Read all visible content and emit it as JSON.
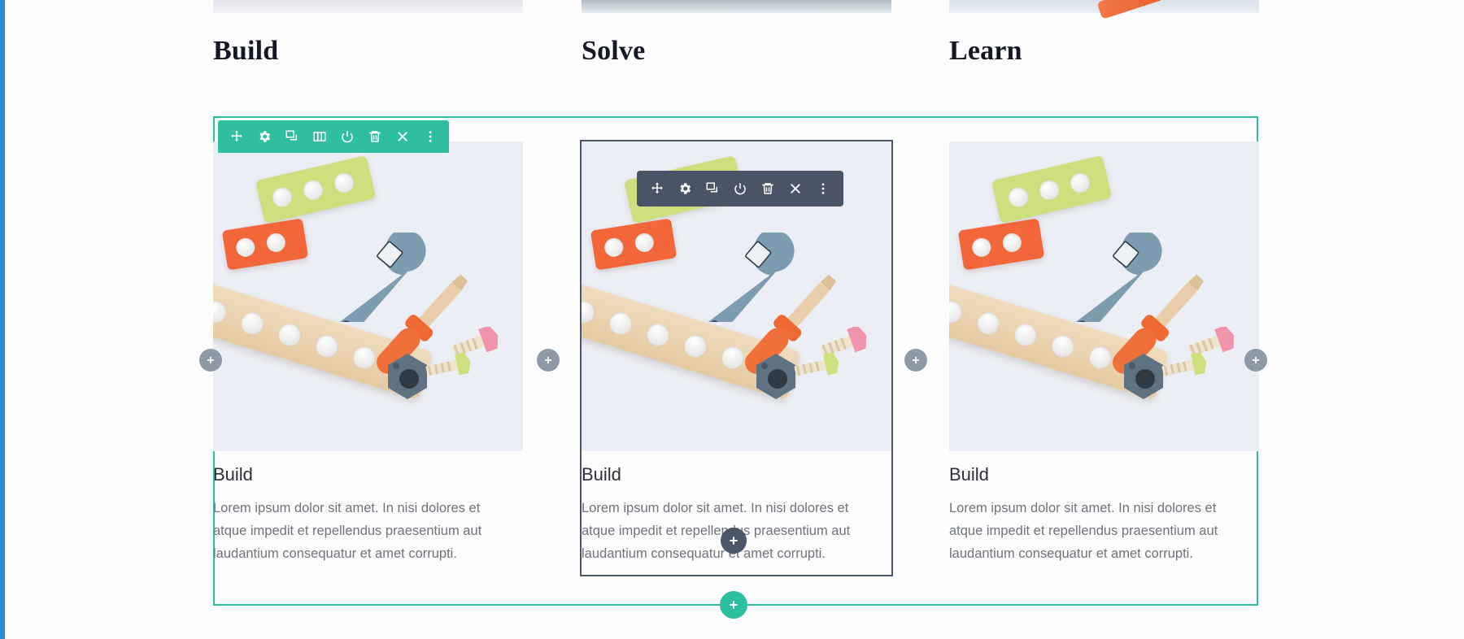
{
  "page": {
    "canvas_bg": "#fdfdfd",
    "editor_rail_color": "#2e8ddb",
    "section_accent": "#2fbfa0",
    "widget_accent": "#495566"
  },
  "headings": [
    {
      "label": "Build"
    },
    {
      "label": "Solve"
    },
    {
      "label": "Learn"
    }
  ],
  "section_toolbar": {
    "name": "section-toolbar",
    "color": "#2fbfa0",
    "items": [
      {
        "icon": "move-icon",
        "label": "Drag section"
      },
      {
        "icon": "gear-icon",
        "label": "Edit section"
      },
      {
        "icon": "duplicate-icon",
        "label": "Duplicate section"
      },
      {
        "icon": "columns-icon",
        "label": "Column structure"
      },
      {
        "icon": "power-icon",
        "label": "Disable section"
      },
      {
        "icon": "trash-icon",
        "label": "Delete section"
      },
      {
        "icon": "close-icon",
        "label": "Close"
      },
      {
        "icon": "more-vertical-icon",
        "label": "More options"
      }
    ]
  },
  "widget_toolbar": {
    "name": "widget-toolbar",
    "color": "#495566",
    "items": [
      {
        "icon": "move-icon",
        "label": "Drag widget"
      },
      {
        "icon": "gear-icon",
        "label": "Edit widget"
      },
      {
        "icon": "duplicate-icon",
        "label": "Duplicate widget"
      },
      {
        "icon": "power-icon",
        "label": "Disable widget"
      },
      {
        "icon": "trash-icon",
        "label": "Delete widget"
      },
      {
        "icon": "close-icon",
        "label": "Close"
      },
      {
        "icon": "more-vertical-icon",
        "label": "More options"
      }
    ]
  },
  "cards": [
    {
      "title": "Build",
      "text": "Lorem ipsum dolor sit amet. In nisi dolores et atque impedit et repellendus praesentium aut laudantium consequatur et amet corrupti.",
      "image_alt": "wooden toy tools flat lay"
    },
    {
      "title": "Build",
      "text": "Lorem ipsum dolor sit amet. In nisi dolores et atque impedit et repellendus praesentium aut laudantium consequatur et amet corrupti.",
      "image_alt": "wooden toy tools flat lay",
      "selected": true
    },
    {
      "title": "Build",
      "text": "Lorem ipsum dolor sit amet. In nisi dolores et atque impedit et repellendus praesentium aut laudantium consequatur et amet corrupti.",
      "image_alt": "wooden toy tools flat lay"
    }
  ],
  "add_buttons": [
    {
      "name": "add-column-left-1",
      "style": "gray",
      "glyph": "+"
    },
    {
      "name": "add-column-left-2",
      "style": "gray",
      "glyph": "+"
    },
    {
      "name": "add-column-left-3",
      "style": "gray",
      "glyph": "+"
    },
    {
      "name": "add-column-right",
      "style": "gray",
      "glyph": "+"
    },
    {
      "name": "add-widget-inline",
      "style": "dark",
      "glyph": "+"
    },
    {
      "name": "add-section-below",
      "style": "green",
      "glyph": "+"
    }
  ]
}
